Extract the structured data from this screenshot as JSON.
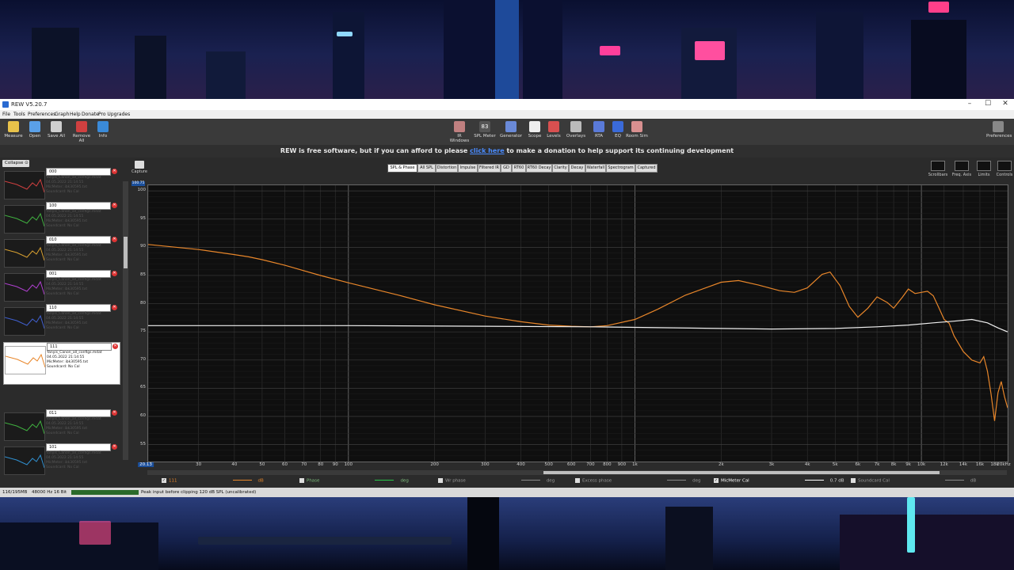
{
  "window": {
    "title": "REW V5.20.7"
  },
  "menu": [
    "File",
    "Tools",
    "Preferences",
    "Graph",
    "Help",
    "Donate",
    "Pro Upgrades"
  ],
  "toolbar_left": [
    {
      "label": "Measure",
      "icon": "microphone-icon"
    },
    {
      "label": "Open",
      "icon": "folder-icon"
    },
    {
      "label": "Save All",
      "icon": "save-icon"
    },
    {
      "label": "Remove All",
      "icon": "remove-icon"
    },
    {
      "label": "Info",
      "icon": "info-icon"
    }
  ],
  "toolbar_center": [
    {
      "label": "IR Windows",
      "icon": "ir-windows-icon"
    },
    {
      "label": "SPL Meter",
      "icon": "spl-meter-icon",
      "value": "83"
    },
    {
      "label": "Generator",
      "icon": "generator-icon"
    },
    {
      "label": "Scope",
      "icon": "scope-icon"
    },
    {
      "label": "Levels",
      "icon": "levels-icon"
    },
    {
      "label": "Overlays",
      "icon": "overlays-icon"
    },
    {
      "label": "RTA",
      "icon": "rta-icon"
    },
    {
      "label": "EQ",
      "icon": "eq-icon"
    },
    {
      "label": "Room Sim",
      "icon": "room-sim-icon"
    }
  ],
  "toolbar_right": {
    "label": "Preferences",
    "icon": "preferences-icon"
  },
  "banner": {
    "before": "REW is free software, but if you can afford to please ",
    "link": "click here",
    "after": " to make a donation to help support its continuing development"
  },
  "left_panel": {
    "collapse_label": "Collapse",
    "measurements": [
      {
        "name": "000",
        "selected": false,
        "info": [
          "Yanyis_Canon_all_configs.mdat",
          "04.05.2022 21:14:55",
          "MicMeter: ibk30595.txt",
          "Soundcard: No Cal"
        ]
      },
      {
        "name": "100",
        "selected": false,
        "info": [
          "Yanyis_Canon_all_configs.mdat",
          "04.05.2022 21:14:55",
          "MicMeter: ibk30595.txt",
          "Soundcard: No Cal"
        ]
      },
      {
        "name": "010",
        "selected": false,
        "info": [
          "Yanyis_Canon_all_configs.mdat",
          "04.05.2022 21:14:55",
          "MicMeter: ibk30595.txt",
          "Soundcard: No Cal"
        ]
      },
      {
        "name": "001",
        "selected": false,
        "info": [
          "Yanyis_Canon_all_configs.mdat",
          "04.05.2022 21:14:55",
          "MicMeter: ibk30595.txt",
          "Soundcard: No Cal"
        ]
      },
      {
        "name": "110",
        "selected": false,
        "info": [
          "Yanyis_Canon_all_configs.mdat",
          "04.05.2022 21:14:55",
          "MicMeter: ibk30595.txt",
          "Soundcard: No Cal"
        ]
      },
      {
        "name": "111",
        "selected": true,
        "info": [
          "Yanyis_Canon_all_configs.mdat",
          "04.05.2022 21:14:55",
          "MicMeter: ibk30595.txt",
          "Soundcard: No Cal"
        ]
      },
      {
        "name": "011",
        "selected": false,
        "info": [
          "Yanyis_Canon_all_configs.mdat",
          "04.05.2022 21:14:55",
          "MicMeter: ibk30595.txt",
          "Soundcard: No Cal"
        ]
      },
      {
        "name": "101",
        "selected": false,
        "info": [
          "Yanyis_Canon_all_configs.mdat",
          "04.05.2022 21:14:55",
          "MicMeter: ibk30595.txt",
          "Soundcard: No Cal"
        ]
      }
    ]
  },
  "capture_label": "Capture",
  "graph_tabs": [
    "SPL & Phase",
    "All SPL",
    "Distortion",
    "Impulse",
    "Filtered IR",
    "GD",
    "RT60",
    "RT60 Decay",
    "Clarity",
    "Decay",
    "Waterfall",
    "Spectrogram",
    "Captured"
  ],
  "active_tab": "SPL & Phase",
  "graph_tools": [
    "Scrollbars",
    "Freq. Axis",
    "Limits",
    "Controls"
  ],
  "cursor_readout": "100.75",
  "cursor_freq": "20.13",
  "legend": [
    {
      "label": "111",
      "unit": "dB",
      "color": "#e8862a",
      "checked": true
    },
    {
      "label": "Phase",
      "unit": "deg",
      "color": "#27c94a",
      "checked": false
    },
    {
      "label": "Wr phase",
      "unit": "deg",
      "color": "#888888",
      "checked": false
    },
    {
      "label": "Excess phase",
      "unit": "deg",
      "color": "#888888",
      "checked": false
    },
    {
      "label": "MicMeter Cal",
      "unit": "0.7 dB",
      "color": "#ffffff",
      "checked": true
    },
    {
      "label": "Soundcard Cal",
      "unit": "dB",
      "color": "#888888",
      "checked": false
    }
  ],
  "status": {
    "memory": "116/195MB",
    "rate": "48000 Hz",
    "bits": "16 Bit",
    "message": "Peak input before clipping 120 dB SPL (uncalibrated)"
  },
  "chart_data": {
    "type": "line",
    "xscale": "log",
    "xlim": [
      20,
      20000
    ],
    "ylim": [
      52,
      101
    ],
    "yticks": [
      55,
      60,
      65,
      70,
      75,
      80,
      85,
      90,
      95,
      100
    ],
    "xticks": [
      {
        "v": 30,
        "l": "30"
      },
      {
        "v": 40,
        "l": "40"
      },
      {
        "v": 50,
        "l": "50"
      },
      {
        "v": 60,
        "l": "60"
      },
      {
        "v": 70,
        "l": "70"
      },
      {
        "v": 80,
        "l": "80"
      },
      {
        "v": 90,
        "l": "90"
      },
      {
        "v": 100,
        "l": "100"
      },
      {
        "v": 200,
        "l": "200"
      },
      {
        "v": 300,
        "l": "300"
      },
      {
        "v": 400,
        "l": "400"
      },
      {
        "v": 500,
        "l": "500"
      },
      {
        "v": 600,
        "l": "600"
      },
      {
        "v": 700,
        "l": "700"
      },
      {
        "v": 800,
        "l": "800"
      },
      {
        "v": 900,
        "l": "900"
      },
      {
        "v": 1000,
        "l": "1k"
      },
      {
        "v": 2000,
        "l": "2k"
      },
      {
        "v": 3000,
        "l": "3k"
      },
      {
        "v": 4000,
        "l": "4k"
      },
      {
        "v": 5000,
        "l": "5k"
      },
      {
        "v": 6000,
        "l": "6k"
      },
      {
        "v": 7000,
        "l": "7k"
      },
      {
        "v": 8000,
        "l": "8k"
      },
      {
        "v": 9000,
        "l": "9k"
      },
      {
        "v": 10000,
        "l": "10k"
      },
      {
        "v": 12000,
        "l": "12k"
      },
      {
        "v": 14000,
        "l": "14k"
      },
      {
        "v": 16000,
        "l": "16k"
      },
      {
        "v": 18000,
        "l": "18k"
      },
      {
        "v": 20000,
        "l": "20kHz"
      }
    ],
    "series": [
      {
        "name": "111",
        "color": "#e8862a",
        "points": [
          [
            20,
            90.5
          ],
          [
            30,
            89.6
          ],
          [
            40,
            88.7
          ],
          [
            45,
            88.3
          ],
          [
            50,
            87.8
          ],
          [
            60,
            86.8
          ],
          [
            80,
            85
          ],
          [
            100,
            83.7
          ],
          [
            150,
            81.5
          ],
          [
            200,
            79.8
          ],
          [
            300,
            77.8
          ],
          [
            400,
            76.8
          ],
          [
            500,
            76.2
          ],
          [
            600,
            76.0
          ],
          [
            700,
            75.9
          ],
          [
            800,
            76.1
          ],
          [
            1000,
            77.2
          ],
          [
            1200,
            79
          ],
          [
            1500,
            81.5
          ],
          [
            2000,
            83.8
          ],
          [
            2300,
            84.1
          ],
          [
            2700,
            83.3
          ],
          [
            3200,
            82.3
          ],
          [
            3600,
            82.0
          ],
          [
            4000,
            82.8
          ],
          [
            4500,
            85.2
          ],
          [
            4800,
            85.6
          ],
          [
            5200,
            83.2
          ],
          [
            5600,
            79.5
          ],
          [
            6000,
            77.6
          ],
          [
            6500,
            79.2
          ],
          [
            7000,
            81.2
          ],
          [
            7600,
            80.2
          ],
          [
            8000,
            79.2
          ],
          [
            8600,
            81.2
          ],
          [
            9000,
            82.6
          ],
          [
            9500,
            81.8
          ],
          [
            10000,
            82.0
          ],
          [
            10500,
            82.2
          ],
          [
            11000,
            81.4
          ],
          [
            11500,
            79.3
          ],
          [
            12000,
            77.2
          ],
          [
            12500,
            76.5
          ],
          [
            13000,
            74.3
          ],
          [
            14000,
            71.5
          ],
          [
            15000,
            70.0
          ],
          [
            16000,
            69.5
          ],
          [
            16500,
            70.6
          ],
          [
            17000,
            68
          ],
          [
            17500,
            64
          ],
          [
            18000,
            59.2
          ],
          [
            18500,
            64.2
          ],
          [
            19000,
            66.2
          ],
          [
            19500,
            63.5
          ],
          [
            20000,
            61.5
          ]
        ]
      },
      {
        "name": "MicMeter Cal",
        "color": "#f0f0f0",
        "points": [
          [
            20,
            76.1
          ],
          [
            100,
            76.1
          ],
          [
            300,
            76.0
          ],
          [
            700,
            75.9
          ],
          [
            1000,
            75.8
          ],
          [
            2000,
            75.6
          ],
          [
            3000,
            75.5
          ],
          [
            5000,
            75.6
          ],
          [
            7000,
            75.9
          ],
          [
            9000,
            76.2
          ],
          [
            11000,
            76.6
          ],
          [
            13000,
            76.9
          ],
          [
            15000,
            77.2
          ],
          [
            17000,
            76.6
          ],
          [
            18500,
            75.7
          ],
          [
            20000,
            75.0
          ]
        ]
      }
    ]
  }
}
